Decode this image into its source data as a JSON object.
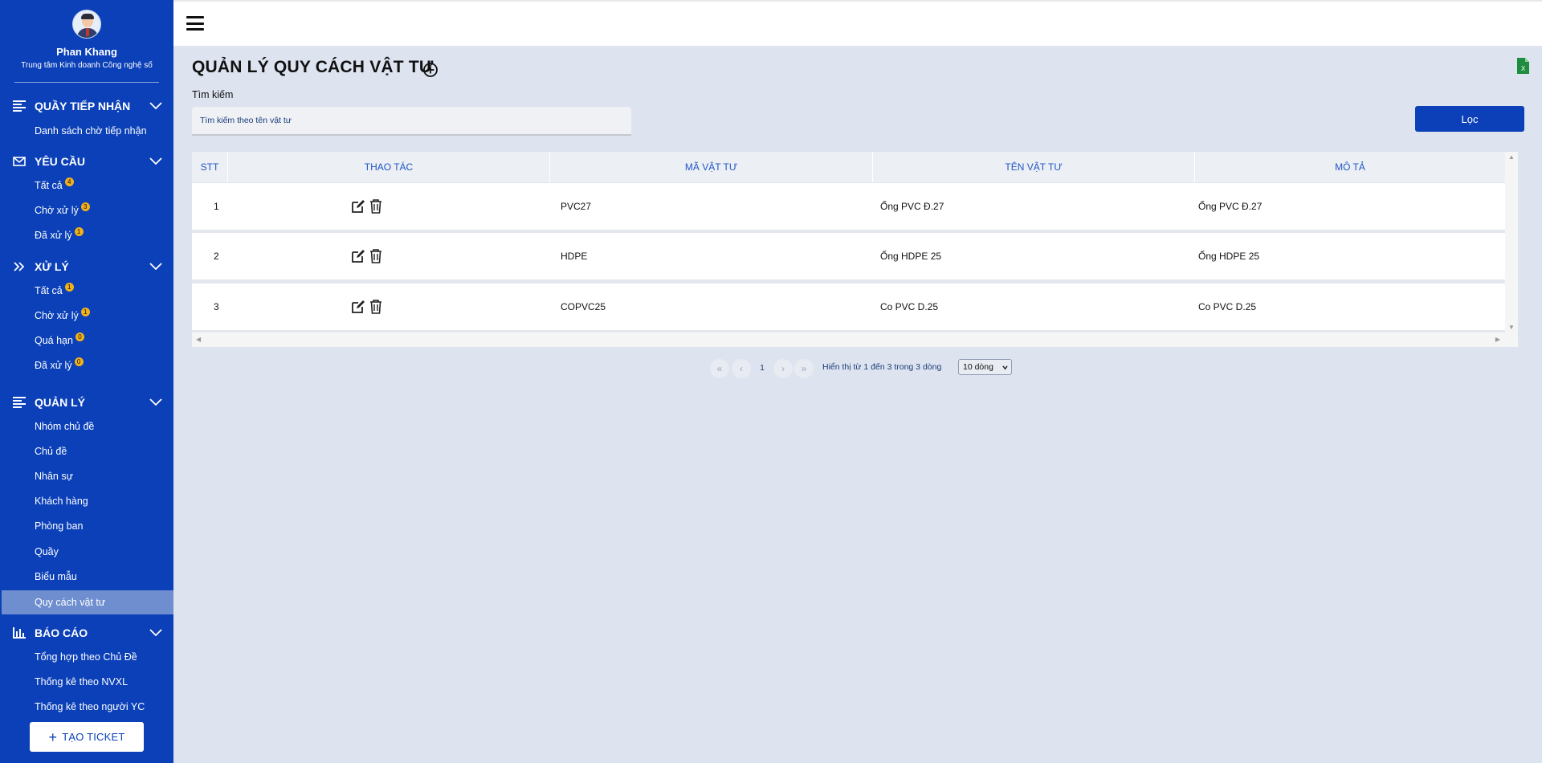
{
  "user": {
    "name": "Phan Khang",
    "org": "Trung tâm Kinh doanh Công nghệ số"
  },
  "sidebar": {
    "sections": [
      {
        "title": "QUẦY TIẾP NHẬN",
        "icon": "list-icon",
        "items": [
          {
            "label": "Danh sách chờ tiếp nhận"
          }
        ]
      },
      {
        "title": "YÊU CẦU",
        "icon": "mail-icon",
        "items": [
          {
            "label": "Tất cả",
            "badge": "4"
          },
          {
            "label": "Chờ xử lý",
            "badge": "3"
          },
          {
            "label": "Đã xử lý",
            "badge": "1"
          }
        ]
      },
      {
        "title": "XỬ LÝ",
        "icon": "double-chevron-right-icon",
        "items": [
          {
            "label": "Tất cả",
            "badge": "1"
          },
          {
            "label": "Chờ xử lý",
            "badge": "1"
          },
          {
            "label": "Quá hạn",
            "badge": "0"
          },
          {
            "label": "Đã xử lý",
            "badge": "0"
          }
        ]
      },
      {
        "title": "QUẢN LÝ",
        "icon": "list-icon",
        "items": [
          {
            "label": "Nhóm chủ đề"
          },
          {
            "label": "Chủ đề"
          },
          {
            "label": "Nhân sự"
          },
          {
            "label": "Khách hàng"
          },
          {
            "label": "Phòng ban"
          },
          {
            "label": "Quầy"
          },
          {
            "label": "Biểu mẫu"
          },
          {
            "label": "Quy cách vật tư",
            "active": true
          }
        ]
      },
      {
        "title": "BÁO CÁO",
        "icon": "bar-chart-icon",
        "items": [
          {
            "label": "Tổng hợp theo Chủ Đề"
          },
          {
            "label": "Thống kê theo NVXL"
          },
          {
            "label": "Thống kê theo người YC"
          }
        ]
      }
    ],
    "create_button": "TẠO TICKET"
  },
  "page": {
    "title": "QUẢN LÝ QUY CÁCH VẬT TƯ",
    "search_label": "Tìm kiếm",
    "search_placeholder": "Tìm kiếm theo tên vật tư",
    "filter_button": "Lọc"
  },
  "table": {
    "headers": [
      "STT",
      "THAO TÁC",
      "MÃ VẬT TƯ",
      "TÊN VẬT TƯ",
      "MÔ TẢ"
    ],
    "rows": [
      {
        "stt": "1",
        "code": "PVC27",
        "name": "Ống PVC Đ.27",
        "desc": "Ống PVC Đ.27"
      },
      {
        "stt": "2",
        "code": "HDPE",
        "name": "Ống HDPE 25",
        "desc": "Ống HDPE 25"
      },
      {
        "stt": "3",
        "code": "COPVC25",
        "name": "Co PVC D.25",
        "desc": "Co PVC D.25"
      }
    ]
  },
  "pagination": {
    "first": "«",
    "prev": "‹",
    "current": "1",
    "next": "›",
    "last": "»",
    "info": "Hiển thị từ 1 đến 3 trong 3 dòng",
    "page_size": "10 dòng"
  },
  "colors": {
    "sidebar": "#0b40b8",
    "active_item": "#6e8ecf",
    "badge": "#f3b21a",
    "header_text": "#1f56c7",
    "excel": "#1e8e3e"
  }
}
